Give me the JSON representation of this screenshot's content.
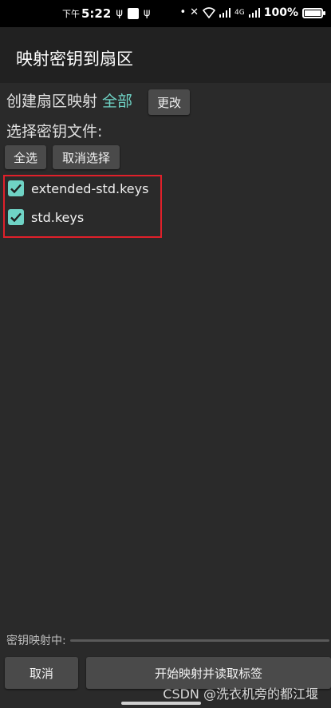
{
  "status_bar": {
    "ampm": "下午",
    "time": "5:22",
    "network": "4G",
    "battery": "100%"
  },
  "app_bar": {
    "title": "映射密钥到扇区"
  },
  "sector_mapping": {
    "label": "创建扇区映射",
    "value": "全部",
    "change_label": "更改"
  },
  "key_file_select": {
    "title": "选择密钥文件:",
    "select_all_label": "全选",
    "deselect_label": "取消选择",
    "files": [
      {
        "name": "extended-std.keys",
        "checked": true
      },
      {
        "name": "std.keys",
        "checked": true
      }
    ]
  },
  "progress": {
    "label": "密钥映射中:",
    "value": 0
  },
  "actions": {
    "cancel_label": "取消",
    "start_label": "开始映射并读取标签"
  },
  "watermark": "CSDN @洗衣机旁的都江堰",
  "colors": {
    "accent": "#6fd3c5",
    "highlight": "#e0202a",
    "background": "#2a2a2a"
  }
}
